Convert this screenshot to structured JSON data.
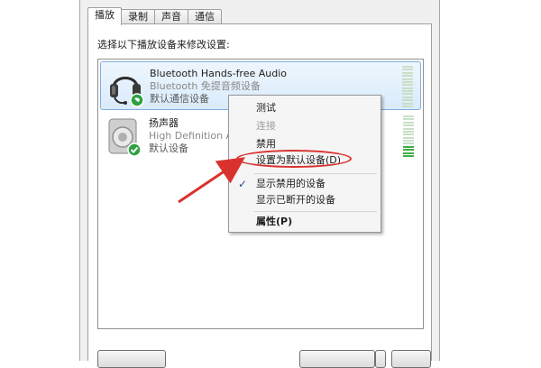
{
  "tabs": [
    {
      "label": "播放",
      "active": true
    },
    {
      "label": "录制",
      "active": false
    },
    {
      "label": "声音",
      "active": false
    },
    {
      "label": "通信",
      "active": false
    }
  ],
  "instruction": "选择以下播放设备来修改设置:",
  "devices": [
    {
      "name": "Bluetooth Hands-free Audio",
      "description": "Bluetooth 免提音频设备",
      "status": "默认通信设备",
      "icon": "headset-icon",
      "selected": true
    },
    {
      "name": "扬声器",
      "description": "High Definition A",
      "status": "默认设备",
      "icon": "speaker-icon",
      "selected": false
    }
  ],
  "context_menu": {
    "items": [
      {
        "label": "测试",
        "disabled": false
      },
      {
        "label": "连接",
        "disabled": true
      },
      {
        "label": "禁用",
        "disabled": false
      },
      {
        "label": "设置为默认设备(D)",
        "disabled": false,
        "highlighted": true
      },
      {
        "label": "显示禁用的设备",
        "checked": true
      },
      {
        "label": "显示已断开的设备",
        "checked": false
      },
      {
        "label": "属性(P)",
        "bold": true
      }
    ]
  },
  "colors": {
    "selection_border": "#84acdd",
    "annotation_red": "#d9322e",
    "status_green": "#3dae48"
  }
}
